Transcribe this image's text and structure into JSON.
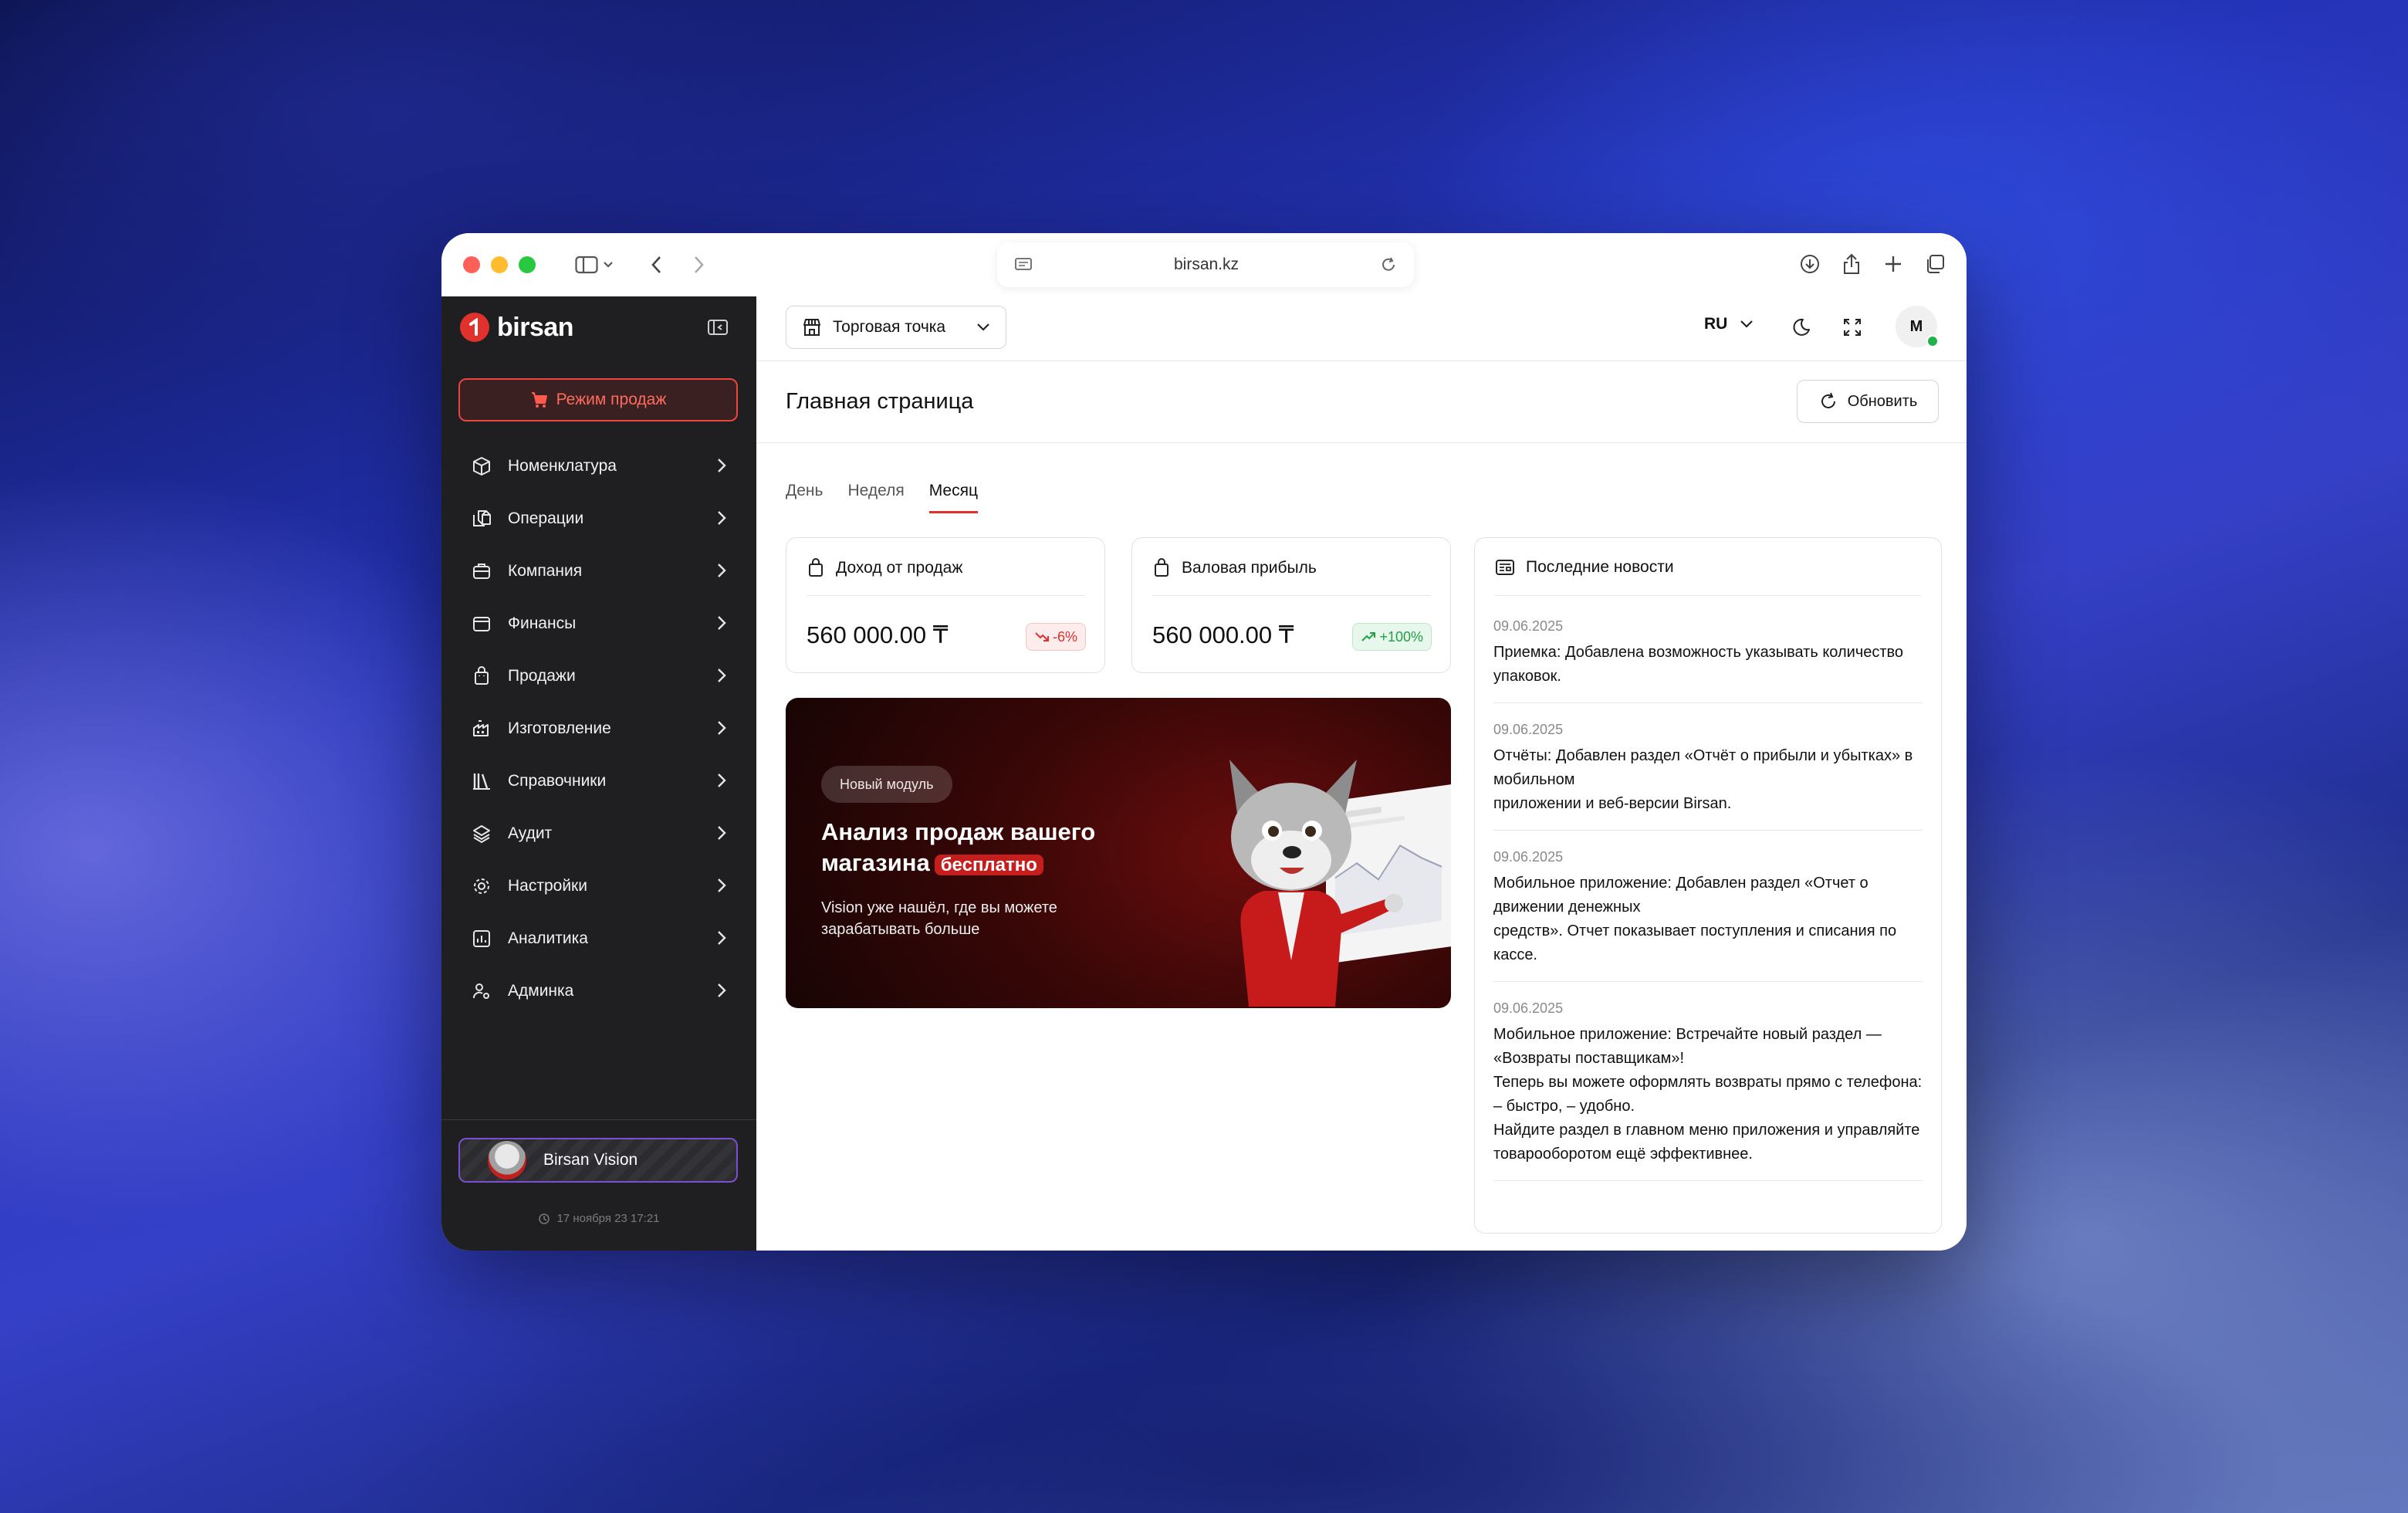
{
  "browser": {
    "url": "birsan.kz"
  },
  "sidebar": {
    "logo": "birsan",
    "sale_mode": "Режим продаж",
    "items": [
      {
        "label": "Номенклатура",
        "icon": "box-icon"
      },
      {
        "label": "Операции",
        "icon": "boxes-icon"
      },
      {
        "label": "Компания",
        "icon": "briefcase-icon"
      },
      {
        "label": "Финансы",
        "icon": "wallet-icon"
      },
      {
        "label": "Продажи",
        "icon": "shopping-bag-icon"
      },
      {
        "label": "Изготовление",
        "icon": "factory-icon"
      },
      {
        "label": "Справочники",
        "icon": "library-icon"
      },
      {
        "label": "Аудит",
        "icon": "layers-icon"
      },
      {
        "label": "Настройки",
        "icon": "gear-icon"
      },
      {
        "label": "Аналитика",
        "icon": "chart-icon"
      },
      {
        "label": "Админка",
        "icon": "user-cog-icon"
      }
    ],
    "vision": "Birsan Vision",
    "timestamp": "17 ноября 23 17:21"
  },
  "topbar": {
    "store_select": "Торговая точка",
    "language": "RU",
    "avatar_initial": "M"
  },
  "page": {
    "title": "Главная страница",
    "refresh": "Обновить",
    "tabs": [
      "День",
      "Неделя",
      "Месяц"
    ],
    "active_tab": "Месяц"
  },
  "kpis": [
    {
      "title": "Доход от продаж",
      "value": "560 000.00 ₸",
      "change": "-6%",
      "trend": "down"
    },
    {
      "title": "Валовая прибыль",
      "value": "560 000.00 ₸",
      "change": "+100%",
      "trend": "up"
    }
  ],
  "banner": {
    "chip": "Новый модуль",
    "title": "Анализ продаж вашего магазина",
    "badge": "бесплатно",
    "subtitle": "Vision уже нашёл, где вы можете зарабатывать больше"
  },
  "news": {
    "title": "Последние новости",
    "items": [
      {
        "date": "09.06.2025",
        "text": "Приемка: Добавлена возможность указывать количество упаковок."
      },
      {
        "date": "09.06.2025",
        "text": "Отчёты: Добавлен раздел «Отчёт о прибыли и убытках» в мобильном\nприложении и веб-версии Birsan."
      },
      {
        "date": "09.06.2025",
        "text": "Мобильное приложение: Добавлен раздел «Отчет о движении денежных\nсредств». Отчет показывает поступления и списания по кассе."
      },
      {
        "date": "09.06.2025",
        "text": "Мобильное приложение: Встречайте новый раздел — «Возвраты поставщикам»!\nТеперь вы можете оформлять возвраты прямо с телефона: – быстро, – удобно.\nНайдите раздел в главном меню приложения и управляйте товарооборотом ещё эффективнее."
      }
    ]
  },
  "colors": {
    "accent": "#e0312d",
    "sidebar_bg": "#1f1f21",
    "success": "#21a047"
  }
}
